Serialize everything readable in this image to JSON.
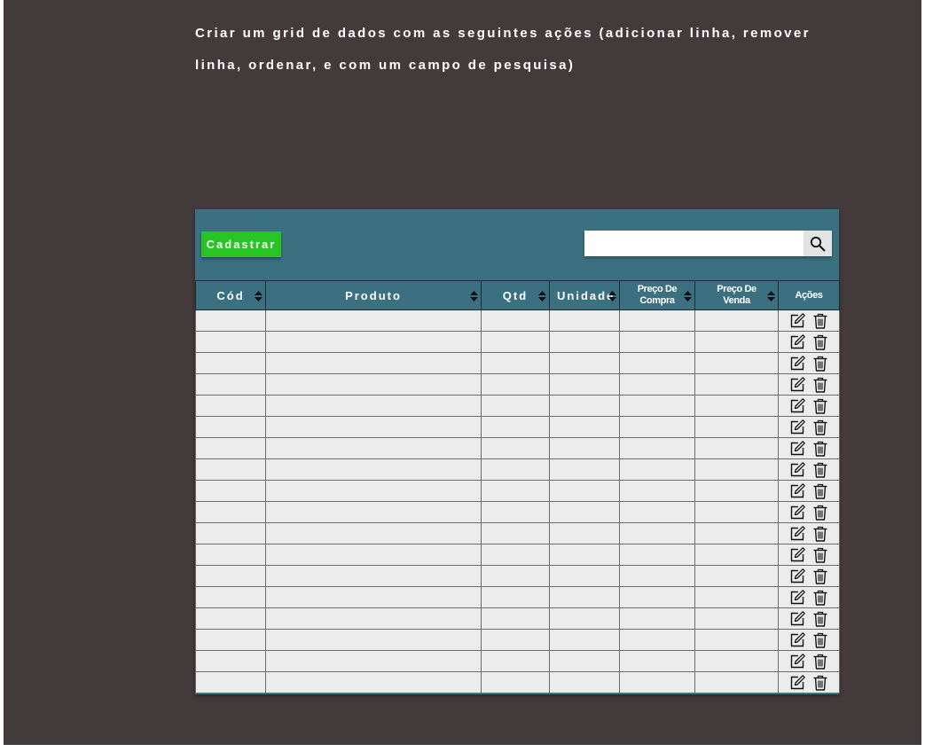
{
  "page": {
    "title": "Criar um grid de dados com as seguintes ações (adicionar linha, remover linha, ordenar, e com um campo de pesquisa)"
  },
  "toolbar": {
    "add_button_label": "Cadastrar",
    "search_placeholder": "",
    "search_value": "",
    "search_icon": "search-icon"
  },
  "grid": {
    "columns": [
      {
        "label": "Cód",
        "sortable": true
      },
      {
        "label": "Produto",
        "sortable": true
      },
      {
        "label": "Qtd",
        "sortable": true
      },
      {
        "label": "Unidade",
        "sortable": true
      },
      {
        "label": "Preço De Compra",
        "sortable": true
      },
      {
        "label": "Preço De Venda",
        "sortable": true
      },
      {
        "label": "Ações",
        "sortable": false
      }
    ],
    "row_count": 18,
    "row_actions": [
      "edit-icon",
      "trash-icon"
    ]
  },
  "colors": {
    "background": "#433a3b",
    "panel": "#3b7080",
    "add_button": "#27c424",
    "cell": "#ececec"
  }
}
